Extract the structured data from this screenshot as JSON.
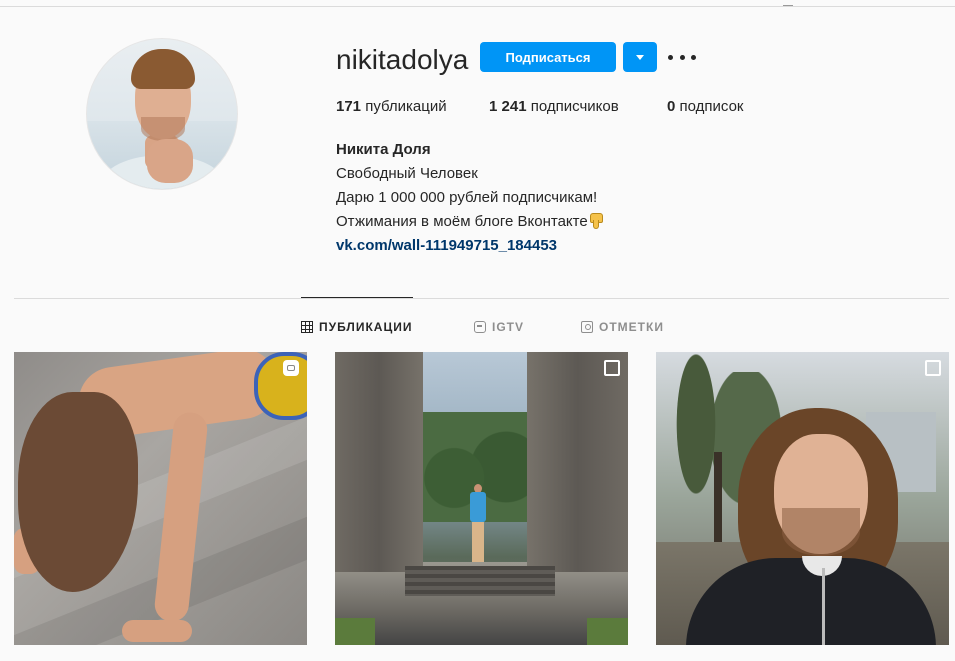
{
  "profile": {
    "username": "nikitadolya",
    "follow_label": "Подписаться",
    "stats": {
      "posts_count": "171",
      "posts_label": "публикаций",
      "followers_count": "1 241",
      "followers_label": "подписчиков",
      "following_count": "0",
      "following_label": "подписок"
    },
    "bio": {
      "name": "Никита Доля",
      "line1": "Свободный Человек",
      "line2": "Дарю 1 000 000 рублей подписчикам!",
      "line3": "Отжимания в моём блоге Вконтакте",
      "line3_emoji": "pointing-down-hand-icon",
      "link": "vk.com/wall-111949715_184453"
    }
  },
  "tabs": [
    {
      "label": "ПУБЛИКАЦИИ",
      "icon": "grid-icon",
      "active": true
    },
    {
      "label": "IGTV",
      "icon": "igtv-icon",
      "active": false
    },
    {
      "label": "ОТМЕТКИ",
      "icon": "tagged-icon",
      "active": false
    }
  ],
  "posts": [
    {
      "type": "igtv-video",
      "icon": "igtv-badge-icon"
    },
    {
      "type": "carousel",
      "icon": "carousel-badge-icon"
    },
    {
      "type": "carousel",
      "icon": "carousel-badge-icon"
    }
  ],
  "colors": {
    "accent": "#0095f6",
    "link": "#00376b",
    "text": "#262626",
    "muted": "#8e8e8e",
    "background": "#fafafa"
  }
}
